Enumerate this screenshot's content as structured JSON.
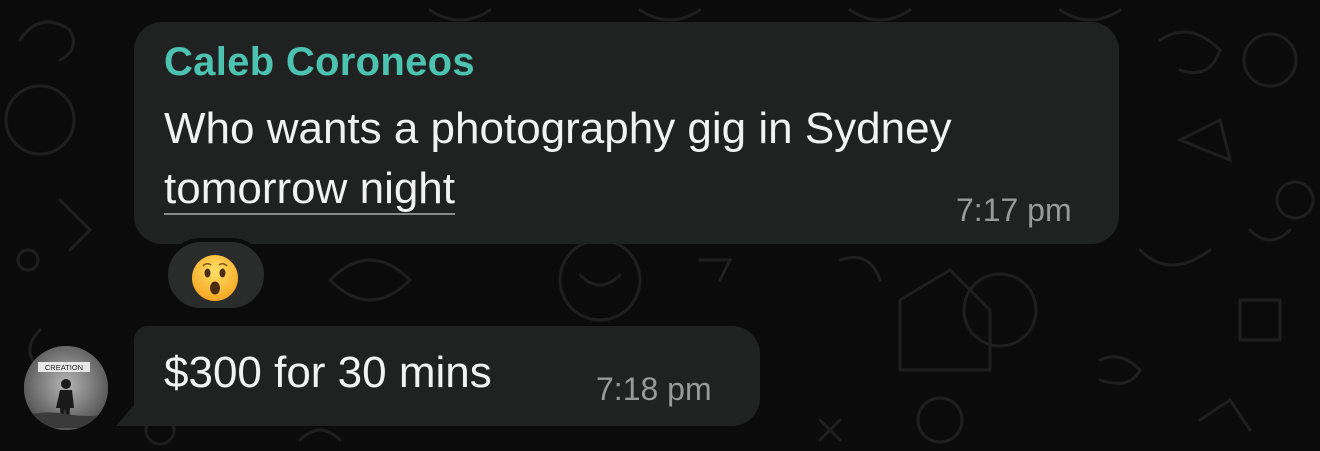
{
  "chat": {
    "messages": [
      {
        "sender": "Caleb Coroneos",
        "text_line1": "Who wants a photography gig in Sydney",
        "text_link": "tomorrow night",
        "time": "7:17 pm",
        "reaction": "astonished-face-icon"
      },
      {
        "text": "$300 for 30 mins",
        "time": "7:18 pm"
      }
    ],
    "avatar": {
      "label": "CREATION",
      "icon": "avatar-person-photo"
    }
  },
  "colors": {
    "background": "#0b0b0b",
    "bubble": "#202222",
    "sender_name": "#4cc3b1",
    "message_text": "#f2f2f2",
    "timestamp": "#9a9a9a"
  }
}
